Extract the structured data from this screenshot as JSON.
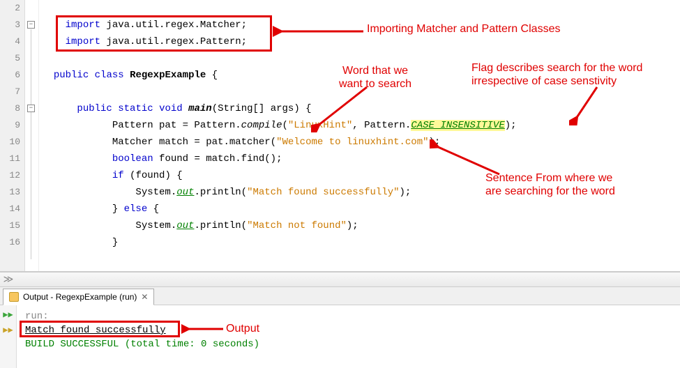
{
  "editor": {
    "line_numbers": [
      "2",
      "3",
      "4",
      "5",
      "6",
      "7",
      "8",
      "9",
      "10",
      "11",
      "12",
      "13",
      "14",
      "15",
      "16"
    ],
    "code": {
      "l3": {
        "kw": "import",
        "rest": " java.util.regex.Matcher;"
      },
      "l4": {
        "kw": "import",
        "rest": " java.util.regex.Pattern;"
      },
      "l6": {
        "kw1": "public",
        "kw2": "class",
        "name": "RegexpExample",
        "rest": " {"
      },
      "l8": {
        "kw1": "public",
        "kw2": "static",
        "kw3": "void",
        "name": "main",
        "rest": "(String[] args) {"
      },
      "l9": {
        "pre": "            Pattern pat = Pattern.",
        "call": "compile",
        "p1": "(",
        "str1": "\"LinuxHint\"",
        "mid": ", Pattern.",
        "flag": "CASE_INSENSITIVE",
        "post": ");"
      },
      "l10": {
        "pre": "            Matcher match = pat.matcher(",
        "str": "\"Welcome to linuxhint.com\"",
        "post": ");"
      },
      "l11": {
        "kw": "boolean",
        "rest": " found = match.find();"
      },
      "l12": {
        "kw": "if",
        "rest": " (found) {"
      },
      "l13": {
        "pre": "                System.",
        "out": "out",
        "mid": ".println(",
        "str": "\"Match found successfully\"",
        "post": ");"
      },
      "l14": {
        "txt": "            } ",
        "kw": "else",
        "rest": " {"
      },
      "l15": {
        "pre": "                System.",
        "out": "out",
        "mid": ".println(",
        "str": "\"Match not found\"",
        "post": ");"
      },
      "l16": {
        "txt": "            }"
      }
    }
  },
  "annotations": {
    "a1": "Importing Matcher and Pattern Classes",
    "a2": "Word that we\nwant to search",
    "a3": "Flag describes search for the word\nirrespective of case senstivity",
    "a4": "Sentence From where we\nare searching for the word",
    "a5": "Output"
  },
  "output": {
    "tab_title": "Output - RegexpExample (run)",
    "lines": {
      "run": "run:",
      "match": "Match found successfully",
      "build": "BUILD SUCCESSFUL (total time: 0 seconds)"
    }
  }
}
